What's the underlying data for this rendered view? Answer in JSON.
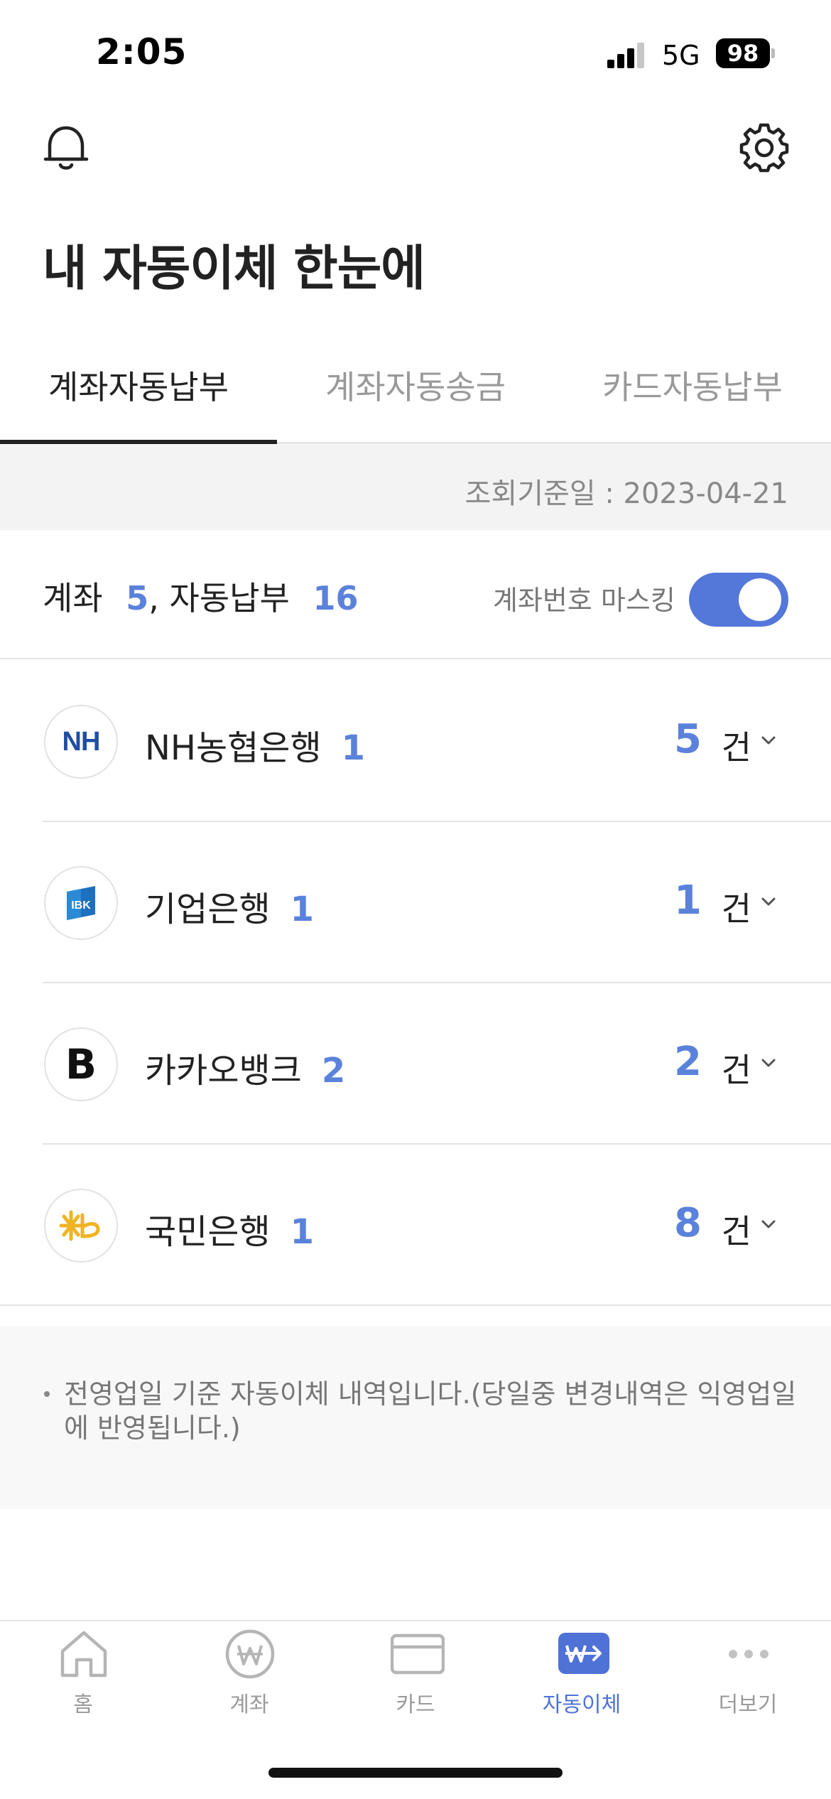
{
  "status": {
    "time": "2:05",
    "network": "5G",
    "battery": "98"
  },
  "header": {
    "title": "내 자동이체 한눈에"
  },
  "tabs": [
    {
      "label": "계좌자동납부",
      "active": true
    },
    {
      "label": "계좌자동송금",
      "active": false
    },
    {
      "label": "카드자동납부",
      "active": false
    }
  ],
  "reference": {
    "date_text": "조회기준일 : 2023-04-21"
  },
  "summary": {
    "account_label": "계좌",
    "account_count": "5",
    "separator": ",",
    "autopay_label": "자동납부",
    "autopay_count": "16",
    "mask_label": "계좌번호 마스킹",
    "mask_on": true
  },
  "banks": [
    {
      "name": "NH농협은행",
      "accounts": "1",
      "count": "5",
      "unit": "건",
      "logo_text": "NH",
      "logo_color": "#1f4ea3"
    },
    {
      "name": "기업은행",
      "accounts": "1",
      "count": "1",
      "unit": "건",
      "logo_text": "IBK",
      "logo_color": "#1d6fbf"
    },
    {
      "name": "카카오뱅크",
      "accounts": "2",
      "count": "2",
      "unit": "건",
      "logo_text": "B",
      "logo_color": "#111111"
    },
    {
      "name": "국민은행",
      "accounts": "1",
      "count": "8",
      "unit": "건",
      "logo_text": "kb",
      "logo_color": "#f0b323"
    }
  ],
  "notice": {
    "text": "전영업일 기준 자동이체 내역입니다.(당일중 변경내역은 익영업일에 반영됩니다.)"
  },
  "nav": [
    {
      "label": "홈",
      "icon": "home-icon",
      "active": false
    },
    {
      "label": "계좌",
      "icon": "won-icon",
      "active": false
    },
    {
      "label": "카드",
      "icon": "card-icon",
      "active": false
    },
    {
      "label": "자동이체",
      "icon": "autotransfer-icon",
      "active": true
    },
    {
      "label": "더보기",
      "icon": "more-icon",
      "active": false
    }
  ],
  "colors": {
    "accent": "#5478d9",
    "number_blue": "#5b82db"
  }
}
